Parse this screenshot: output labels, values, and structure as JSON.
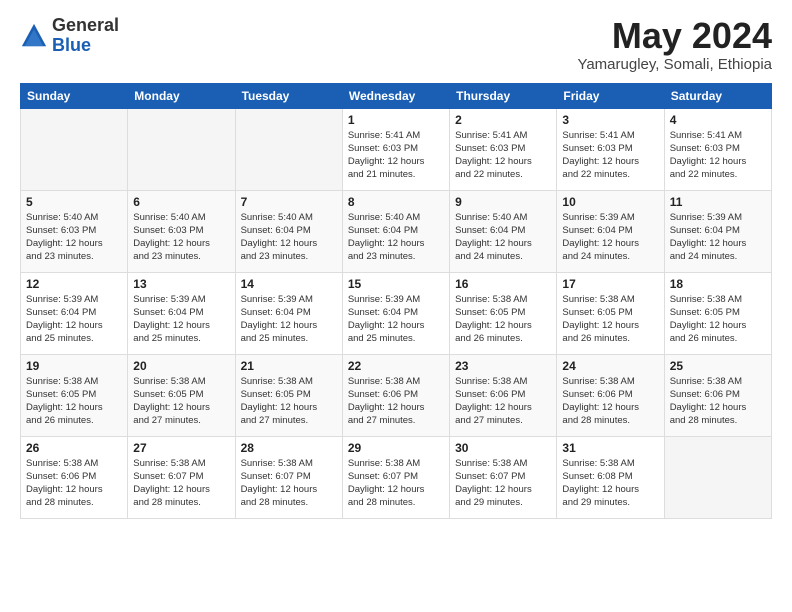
{
  "logo": {
    "general": "General",
    "blue": "Blue"
  },
  "title": "May 2024",
  "subtitle": "Yamarugley, Somali, Ethiopia",
  "headers": [
    "Sunday",
    "Monday",
    "Tuesday",
    "Wednesday",
    "Thursday",
    "Friday",
    "Saturday"
  ],
  "weeks": [
    [
      {
        "day": "",
        "info": ""
      },
      {
        "day": "",
        "info": ""
      },
      {
        "day": "",
        "info": ""
      },
      {
        "day": "1",
        "info": "Sunrise: 5:41 AM\nSunset: 6:03 PM\nDaylight: 12 hours\nand 21 minutes."
      },
      {
        "day": "2",
        "info": "Sunrise: 5:41 AM\nSunset: 6:03 PM\nDaylight: 12 hours\nand 22 minutes."
      },
      {
        "day": "3",
        "info": "Sunrise: 5:41 AM\nSunset: 6:03 PM\nDaylight: 12 hours\nand 22 minutes."
      },
      {
        "day": "4",
        "info": "Sunrise: 5:41 AM\nSunset: 6:03 PM\nDaylight: 12 hours\nand 22 minutes."
      }
    ],
    [
      {
        "day": "5",
        "info": "Sunrise: 5:40 AM\nSunset: 6:03 PM\nDaylight: 12 hours\nand 23 minutes."
      },
      {
        "day": "6",
        "info": "Sunrise: 5:40 AM\nSunset: 6:03 PM\nDaylight: 12 hours\nand 23 minutes."
      },
      {
        "day": "7",
        "info": "Sunrise: 5:40 AM\nSunset: 6:04 PM\nDaylight: 12 hours\nand 23 minutes."
      },
      {
        "day": "8",
        "info": "Sunrise: 5:40 AM\nSunset: 6:04 PM\nDaylight: 12 hours\nand 23 minutes."
      },
      {
        "day": "9",
        "info": "Sunrise: 5:40 AM\nSunset: 6:04 PM\nDaylight: 12 hours\nand 24 minutes."
      },
      {
        "day": "10",
        "info": "Sunrise: 5:39 AM\nSunset: 6:04 PM\nDaylight: 12 hours\nand 24 minutes."
      },
      {
        "day": "11",
        "info": "Sunrise: 5:39 AM\nSunset: 6:04 PM\nDaylight: 12 hours\nand 24 minutes."
      }
    ],
    [
      {
        "day": "12",
        "info": "Sunrise: 5:39 AM\nSunset: 6:04 PM\nDaylight: 12 hours\nand 25 minutes."
      },
      {
        "day": "13",
        "info": "Sunrise: 5:39 AM\nSunset: 6:04 PM\nDaylight: 12 hours\nand 25 minutes."
      },
      {
        "day": "14",
        "info": "Sunrise: 5:39 AM\nSunset: 6:04 PM\nDaylight: 12 hours\nand 25 minutes."
      },
      {
        "day": "15",
        "info": "Sunrise: 5:39 AM\nSunset: 6:04 PM\nDaylight: 12 hours\nand 25 minutes."
      },
      {
        "day": "16",
        "info": "Sunrise: 5:38 AM\nSunset: 6:05 PM\nDaylight: 12 hours\nand 26 minutes."
      },
      {
        "day": "17",
        "info": "Sunrise: 5:38 AM\nSunset: 6:05 PM\nDaylight: 12 hours\nand 26 minutes."
      },
      {
        "day": "18",
        "info": "Sunrise: 5:38 AM\nSunset: 6:05 PM\nDaylight: 12 hours\nand 26 minutes."
      }
    ],
    [
      {
        "day": "19",
        "info": "Sunrise: 5:38 AM\nSunset: 6:05 PM\nDaylight: 12 hours\nand 26 minutes."
      },
      {
        "day": "20",
        "info": "Sunrise: 5:38 AM\nSunset: 6:05 PM\nDaylight: 12 hours\nand 27 minutes."
      },
      {
        "day": "21",
        "info": "Sunrise: 5:38 AM\nSunset: 6:05 PM\nDaylight: 12 hours\nand 27 minutes."
      },
      {
        "day": "22",
        "info": "Sunrise: 5:38 AM\nSunset: 6:06 PM\nDaylight: 12 hours\nand 27 minutes."
      },
      {
        "day": "23",
        "info": "Sunrise: 5:38 AM\nSunset: 6:06 PM\nDaylight: 12 hours\nand 27 minutes."
      },
      {
        "day": "24",
        "info": "Sunrise: 5:38 AM\nSunset: 6:06 PM\nDaylight: 12 hours\nand 28 minutes."
      },
      {
        "day": "25",
        "info": "Sunrise: 5:38 AM\nSunset: 6:06 PM\nDaylight: 12 hours\nand 28 minutes."
      }
    ],
    [
      {
        "day": "26",
        "info": "Sunrise: 5:38 AM\nSunset: 6:06 PM\nDaylight: 12 hours\nand 28 minutes."
      },
      {
        "day": "27",
        "info": "Sunrise: 5:38 AM\nSunset: 6:07 PM\nDaylight: 12 hours\nand 28 minutes."
      },
      {
        "day": "28",
        "info": "Sunrise: 5:38 AM\nSunset: 6:07 PM\nDaylight: 12 hours\nand 28 minutes."
      },
      {
        "day": "29",
        "info": "Sunrise: 5:38 AM\nSunset: 6:07 PM\nDaylight: 12 hours\nand 28 minutes."
      },
      {
        "day": "30",
        "info": "Sunrise: 5:38 AM\nSunset: 6:07 PM\nDaylight: 12 hours\nand 29 minutes."
      },
      {
        "day": "31",
        "info": "Sunrise: 5:38 AM\nSunset: 6:08 PM\nDaylight: 12 hours\nand 29 minutes."
      },
      {
        "day": "",
        "info": ""
      }
    ]
  ]
}
